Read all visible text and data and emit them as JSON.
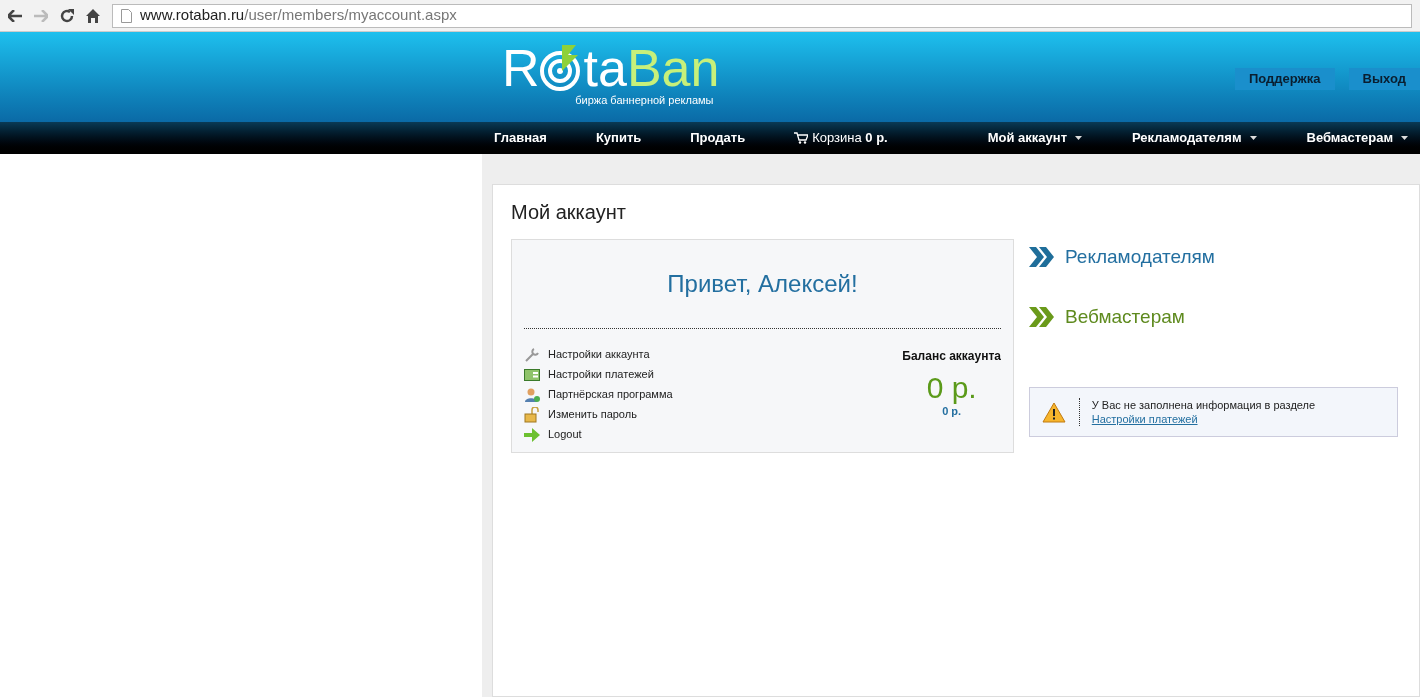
{
  "browser": {
    "url_host": "www.rotaban.ru",
    "url_path": "/user/members/myaccount.aspx"
  },
  "logo": {
    "parts": [
      "R",
      "ta",
      "Ban"
    ],
    "tagline": "биржа баннерной рекламы"
  },
  "top_links": [
    "Поддержка",
    "Выход"
  ],
  "nav": [
    {
      "label": "Главная",
      "has_menu": false
    },
    {
      "label": "Купить",
      "has_menu": false
    },
    {
      "label": "Продать",
      "has_menu": false
    }
  ],
  "cart": {
    "label": "Корзина",
    "amount": "0 р."
  },
  "nav_right": [
    {
      "label": "Мой аккаунт",
      "has_menu": true
    },
    {
      "label": "Рекламодателям",
      "has_menu": true
    },
    {
      "label": "Вебмастерам",
      "has_menu": true
    }
  ],
  "page_title": "Мой аккаунт",
  "greeting": "Привет, Алексей!",
  "account_menu": [
    {
      "kind": "wrench",
      "label": "Настройки аккаунта"
    },
    {
      "kind": "card",
      "label": "Настройки платежей"
    },
    {
      "kind": "user",
      "label": "Партнёрская программа"
    },
    {
      "kind": "lock",
      "label": "Изменить пароль"
    },
    {
      "kind": "arrow",
      "label": "Logout"
    }
  ],
  "balance": {
    "title": "Баланс аккаунта",
    "amount": "0 р.",
    "sub_amount": "0 р."
  },
  "sections": [
    {
      "kind": "blue",
      "label": "Рекламодателям"
    },
    {
      "kind": "green",
      "label": "Вебмастерам"
    }
  ],
  "warning": {
    "text": "У Вас не заполнена информация в разделе",
    "link": "Настройки платежей"
  }
}
